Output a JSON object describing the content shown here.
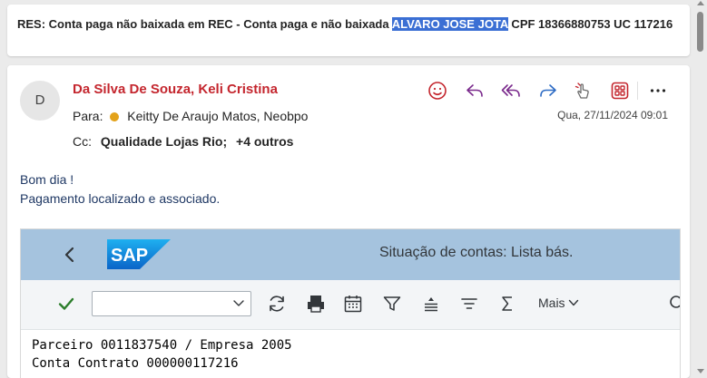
{
  "subject": {
    "before": "RES: Conta paga não baixada em REC - Conta paga e não baixada ",
    "highlight": "ALVARO JOSE JOTA",
    "after": "  CPF 18366880753  UC 117216"
  },
  "message": {
    "avatar_initial": "D",
    "sender": "Da Silva De Souza, Keli Cristina",
    "to_label": "Para:",
    "to_value": "Keitty De Araujo Matos, Neobpo",
    "cc_label": "Cc:",
    "cc_value": "Qualidade Lojas Rio;",
    "cc_more": "+4 outros",
    "date": "Qua, 27/11/2024 09:01",
    "body_lines": [
      "Bom dia !",
      "Pagamento localizado e associado."
    ],
    "actions": [
      "smiley-icon",
      "reply-icon",
      "reply-all-icon",
      "forward-icon",
      "touch-icon",
      "apps-icon",
      "more-icon"
    ],
    "colors": {
      "sender": "#c4262e",
      "body": "#1f3864",
      "highlight": "#3b6fd4"
    }
  },
  "sap": {
    "logo_text": "SAP",
    "title": "Situação de contas: Lista bás.",
    "select_value": "",
    "more_label": "Mais",
    "toolbar_icons": [
      "check-icon",
      "refresh-icon",
      "printer-icon",
      "calendar-icon",
      "filter-icon",
      "align-icon",
      "menu-icon",
      "sum-icon",
      "search-icon"
    ],
    "content_lines": [
      "Parceiro 0011837540 / Empresa 2005",
      "Conta Contrato 000000117216"
    ],
    "colors": {
      "header": "#a5c3de",
      "check": "#2b7d2b"
    }
  }
}
